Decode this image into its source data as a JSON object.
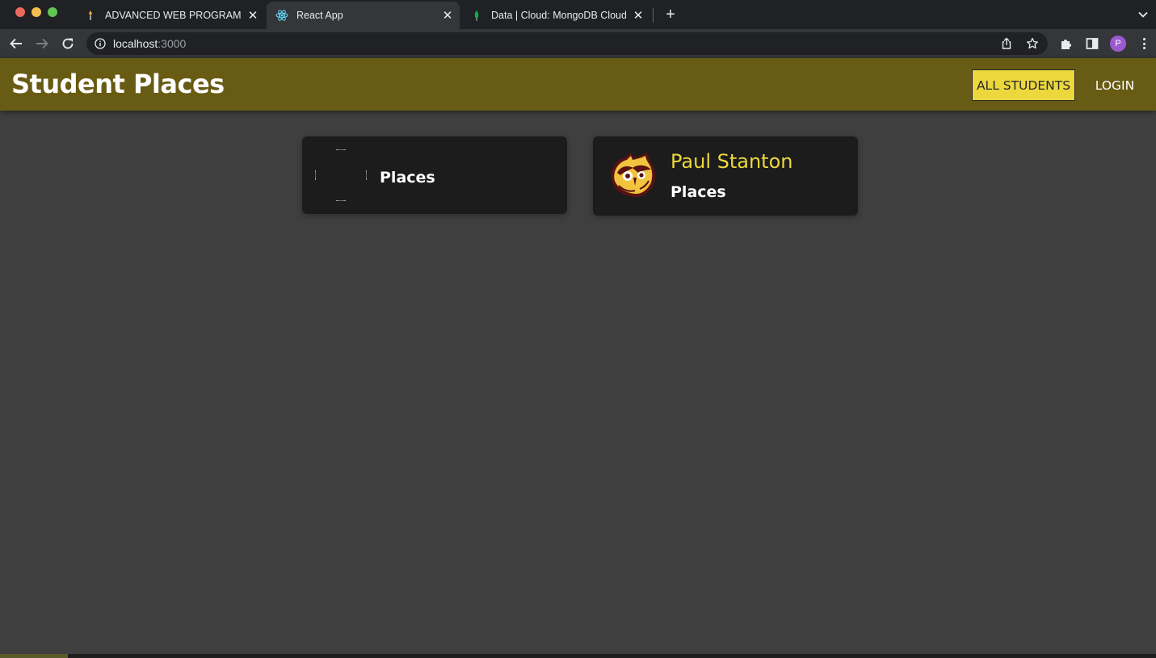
{
  "browser": {
    "tabs": [
      {
        "title": "ADVANCED WEB PROGRAMMI",
        "close": "✕",
        "active": false
      },
      {
        "title": "React App",
        "close": "✕",
        "active": true
      },
      {
        "title": "Data | Cloud: MongoDB Cloud",
        "close": "✕",
        "active": false
      }
    ],
    "new_tab": "+",
    "url_host": "localhost",
    "url_port": ":3000",
    "profile_initial": "P"
  },
  "app": {
    "title": "Student Places",
    "nav": {
      "all_students": "ALL STUDENTS",
      "login": "LOGIN"
    },
    "students": [
      {
        "name": "",
        "places_label": "Places",
        "has_image": false
      },
      {
        "name": "Paul Stanton",
        "places_label": "Places",
        "has_image": true
      }
    ]
  },
  "colors": {
    "header_bg": "#685b13",
    "accent": "#ecd83c",
    "page_bg": "#3f3f40",
    "card_bg": "#1c1c1c"
  },
  "icons": [
    "back-arrow-icon",
    "forward-arrow-icon",
    "reload-icon",
    "info-icon",
    "share-icon",
    "star-icon",
    "extensions-icon",
    "sidepanel-icon",
    "kebab-menu-icon",
    "owl-logo"
  ]
}
